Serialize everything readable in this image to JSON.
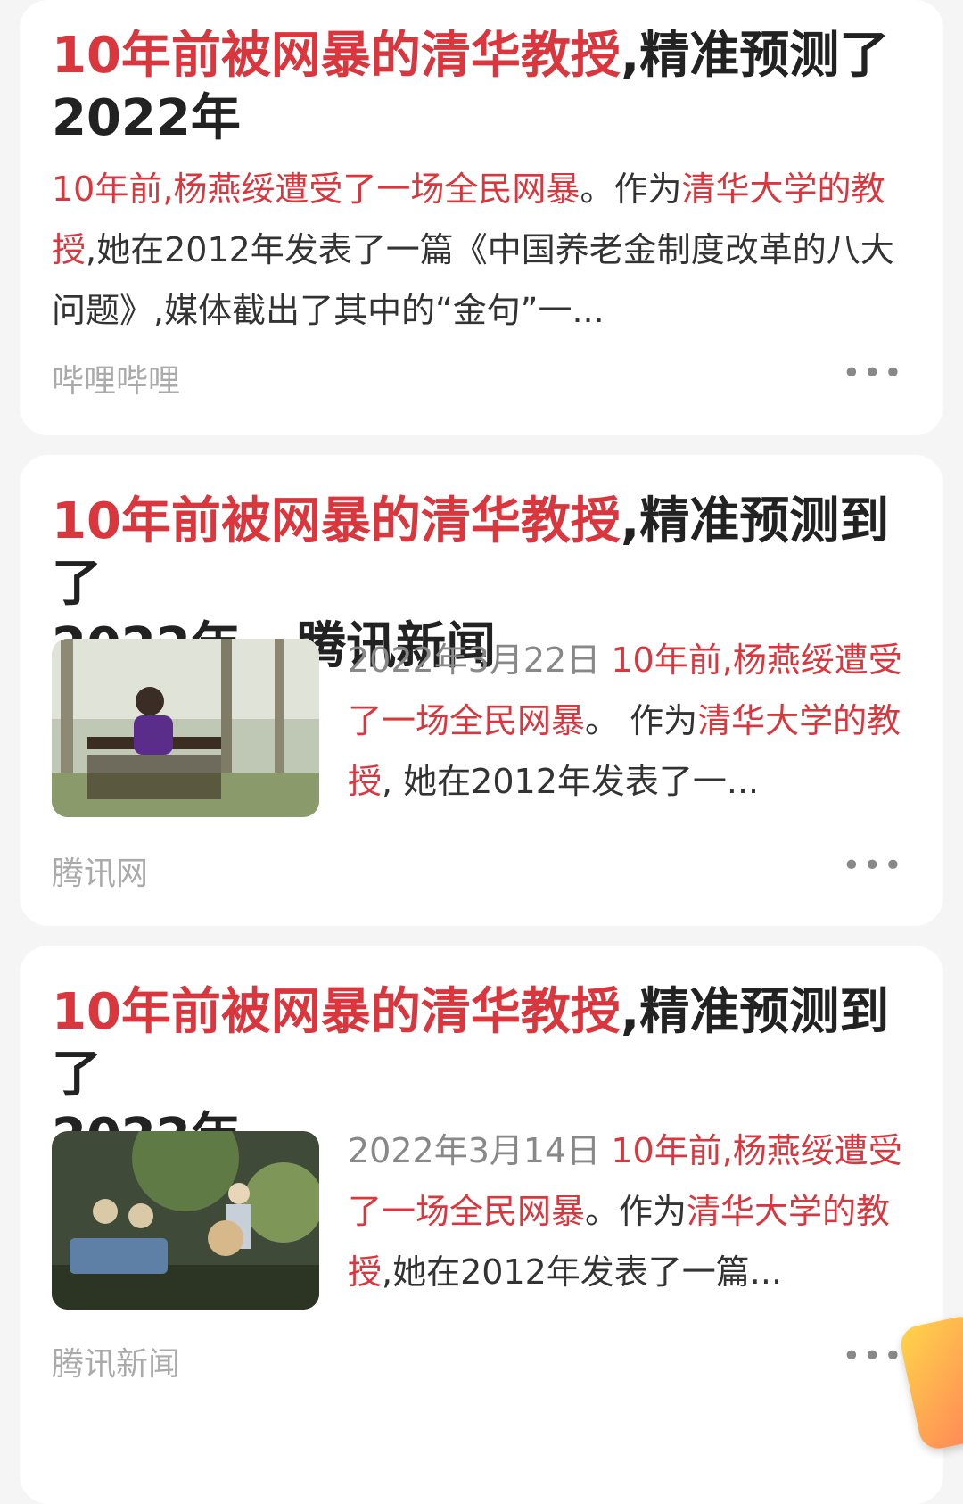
{
  "results": [
    {
      "title_red": "10年前被网暴的清华教授",
      "title_rest": ",精准预测了",
      "title_line2": "2022年",
      "snippet": {
        "p1_red": "10年前,杨燕绥遭受了一场全民网暴",
        "p2": "。作为",
        "p3_red": "清华大学的教授",
        "p4": ",她在2012年发表了一篇《中国养老金制度改革的八大问题》,媒体截出了其中的“金句”一..."
      },
      "source": "哔哩哔哩",
      "more": "•••"
    },
    {
      "title_red": "10年前被网暴的清华教授",
      "title_rest": ",精准预测到了",
      "title_line2": "2022年 - 腾讯新闻",
      "date": "2022年3月22日",
      "snippet": {
        "p1_red": "10年前,杨燕绥遭受了一场全民网暴",
        "p2": "。 作为",
        "p3_red": "清华大学的教授",
        "p4": ", 她在2012年发表了一..."
      },
      "source": "腾讯网",
      "more": "•••"
    },
    {
      "title_red": "10年前被网暴的清华教授",
      "title_rest": ",精准预测到了",
      "title_line2": "2022年",
      "date": "2022年3月14日",
      "snippet": {
        "p1_red": "10年前,杨燕绥遭受了一场全民网暴",
        "p2": "。作为",
        "p3_red": "清华大学的教授",
        "p4": ",她在2012年发表了一篇..."
      },
      "source": "腾讯新闻",
      "more": "•••"
    }
  ]
}
